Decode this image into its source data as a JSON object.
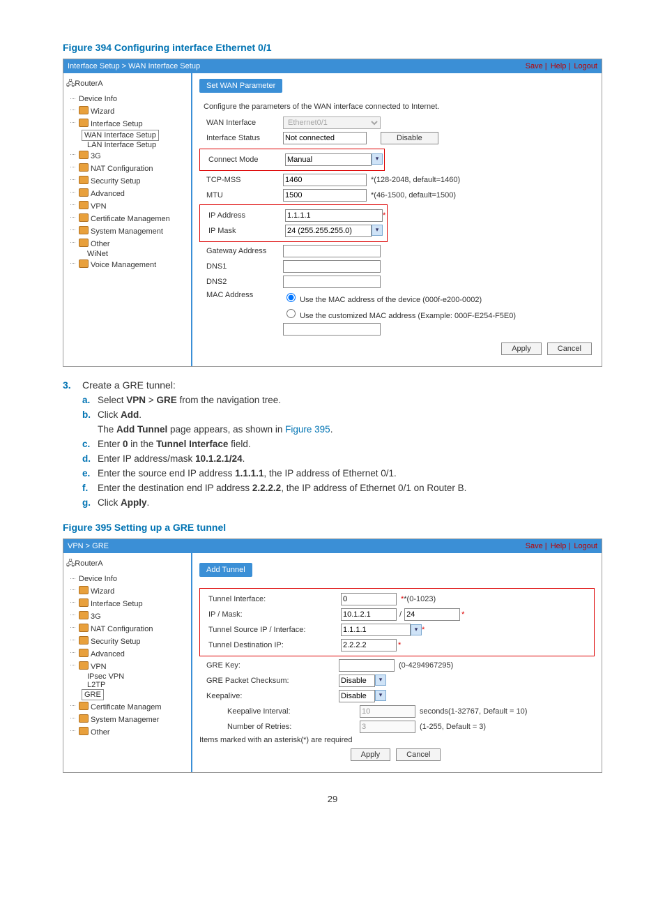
{
  "figure1": {
    "title": "Figure 394 Configuring interface Ethernet 0/1",
    "breadcrumb": "Interface Setup > WAN Interface Setup",
    "actions": {
      "save": "Save",
      "help": "Help",
      "logout": "Logout"
    },
    "device": "RouterA",
    "nav": {
      "device_info": "Device Info",
      "wizard": "Wizard",
      "interface_setup": "Interface Setup",
      "wan_setup": "WAN Interface Setup",
      "lan_setup": "LAN Interface Setup",
      "three_g": "3G",
      "nat": "NAT Configuration",
      "security": "Security Setup",
      "advanced": "Advanced",
      "vpn": "VPN",
      "cert": "Certificate Managemen",
      "sysmgmt": "System Management",
      "other": "Other",
      "winet": "WiNet",
      "voice": "Voice Management"
    },
    "tab": "Set WAN Parameter",
    "desc": "Configure the parameters of the WAN interface connected to Internet.",
    "fields": {
      "wan_interface_lbl": "WAN Interface",
      "wan_interface_val": "Ethernet0/1",
      "status_lbl": "Interface Status",
      "status_val": "Not connected",
      "disable_btn": "Disable",
      "connect_lbl": "Connect Mode",
      "connect_val": "Manual",
      "tcpmss_lbl": "TCP-MSS",
      "tcpmss_val": "1460",
      "tcpmss_hint": "*(128-2048, default=1460)",
      "mtu_lbl": "MTU",
      "mtu_val": "1500",
      "mtu_hint": "*(46-1500, default=1500)",
      "ip_lbl": "IP Address",
      "ip_val": "1.1.1.1",
      "mask_lbl": "IP Mask",
      "mask_val": "24 (255.255.255.0)",
      "gw_lbl": "Gateway Address",
      "dns1_lbl": "DNS1",
      "dns2_lbl": "DNS2",
      "mac_lbl": "MAC Address",
      "mac_opt1": "Use the MAC address of the device (000f-e200-0002)",
      "mac_opt2": "Use the customized MAC address (Example: 000F-E254-F5E0)",
      "apply": "Apply",
      "cancel": "Cancel"
    }
  },
  "instructions": {
    "step_num": "3.",
    "step_text": "Create a GRE tunnel:",
    "a_pref": "a.",
    "a_t1": "Select ",
    "a_b1": "VPN",
    "a_t2": " > ",
    "a_b2": "GRE",
    "a_t3": " from the navigation tree.",
    "b_pref": "b.",
    "b_t1": "Click ",
    "b_b1": "Add",
    "b_t2": ".",
    "b_line2a": "The ",
    "b_line2b": "Add Tunnel",
    "b_line2c": " page appears, as shown in ",
    "b_link": "Figure 395",
    "b_line2d": ".",
    "c_pref": "c.",
    "c_t1": "Enter ",
    "c_b1": "0",
    "c_t2": " in the ",
    "c_b2": "Tunnel Interface",
    "c_t3": " field.",
    "d_pref": "d.",
    "d_t1": "Enter IP address/mask ",
    "d_b1": "10.1.2.1/24",
    "d_t2": ".",
    "e_pref": "e.",
    "e_t1": "Enter the source end IP address ",
    "e_b1": "1.1.1.1",
    "e_t2": ", the IP address of Ethernet 0/1.",
    "f_pref": "f.",
    "f_t1": "Enter the destination end IP address ",
    "f_b1": "2.2.2.2",
    "f_t2": ", the IP address of Ethernet 0/1 on Router B.",
    "g_pref": "g.",
    "g_t1": "Click ",
    "g_b1": "Apply",
    "g_t2": "."
  },
  "figure2": {
    "title": "Figure 395 Setting up a GRE tunnel",
    "breadcrumb": "VPN > GRE",
    "actions": {
      "save": "Save",
      "help": "Help",
      "logout": "Logout"
    },
    "device": "RouterA",
    "nav": {
      "device_info": "Device Info",
      "wizard": "Wizard",
      "interface_setup": "Interface Setup",
      "three_g": "3G",
      "nat": "NAT Configuration",
      "security": "Security Setup",
      "advanced": "Advanced",
      "vpn": "VPN",
      "ipsec": "IPsec VPN",
      "l2tp": "L2TP",
      "gre": "GRE",
      "cert": "Certificate Managem",
      "sysmgmt": "System Managemer",
      "other": "Other"
    },
    "tab": "Add Tunnel",
    "fields": {
      "tiface_lbl": "Tunnel Interface:",
      "tiface_val": "0",
      "tiface_hint": "*(0-1023)",
      "ipmask_lbl": "IP / Mask:",
      "ipmask_ip": "10.1.2.1",
      "ipmask_mask": "24",
      "src_lbl": "Tunnel Source IP / Interface:",
      "src_val": "1.1.1.1",
      "dst_lbl": "Tunnel Destination IP:",
      "dst_val": "2.2.2.2",
      "grekey_lbl": "GRE Key:",
      "grekey_hint": "(0-4294967295)",
      "checksum_lbl": "GRE Packet Checksum:",
      "checksum_val": "Disable",
      "keepalive_lbl": "Keepalive:",
      "keepalive_val": "Disable",
      "kint_lbl": "Keepalive Interval:",
      "kint_val": "10",
      "kint_hint": "seconds(1-32767, Default = 10)",
      "retries_lbl": "Number of Retries:",
      "retries_val": "3",
      "retries_hint": "(1-255, Default = 3)",
      "note": "Items marked with an asterisk(*) are required",
      "apply": "Apply",
      "cancel": "Cancel"
    }
  },
  "page_number": "29"
}
